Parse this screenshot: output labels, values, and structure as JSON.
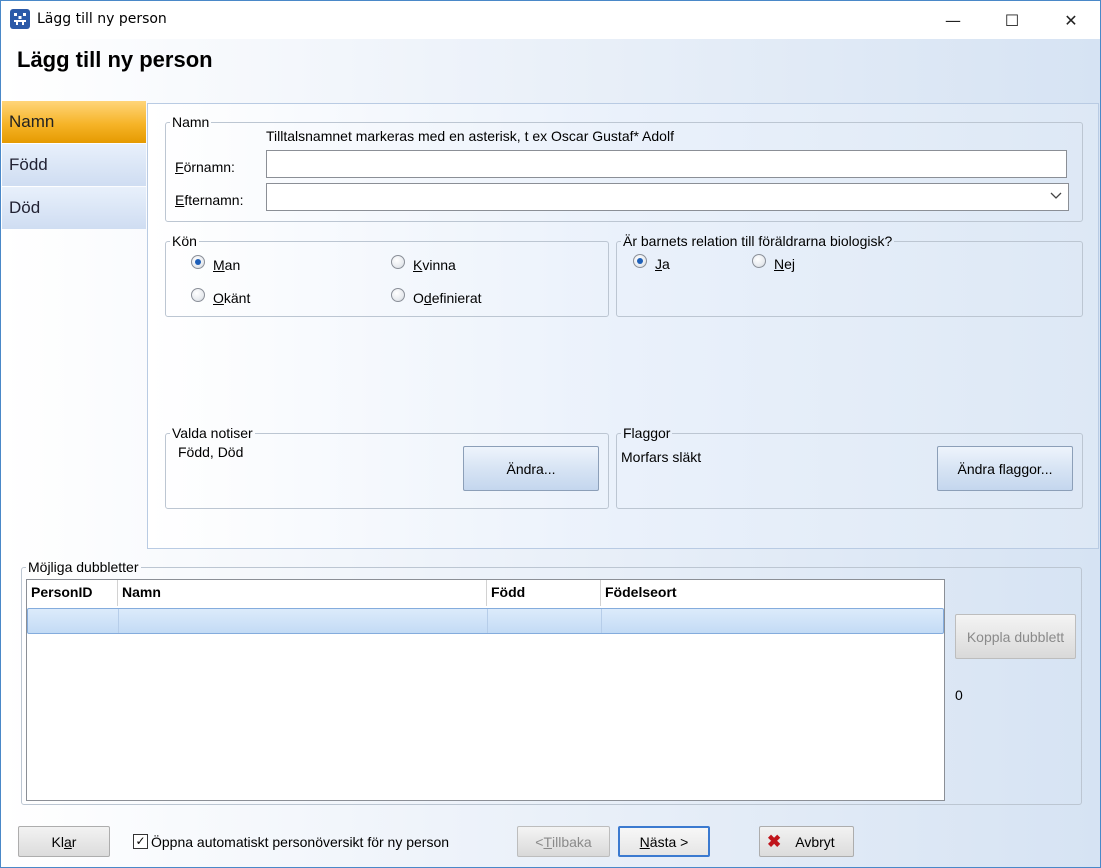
{
  "window": {
    "title": "Lägg till ny person",
    "minimize_glyph": "—",
    "maximize_glyph": "☐",
    "close_glyph": "✕"
  },
  "header": {
    "title": "Lägg till ny person"
  },
  "nav": {
    "items": [
      {
        "label": "Namn",
        "active": true
      },
      {
        "label": "Född",
        "active": false
      },
      {
        "label": "Död",
        "active": false
      }
    ]
  },
  "name_group": {
    "legend": "Namn",
    "hint": "Tilltalsnamnet markeras med en asterisk, t ex  Oscar Gustaf* Adolf",
    "fornamn_label_pre": "",
    "fornamn_label_key": "F",
    "fornamn_label_post": "örnamn:",
    "fornamn_value": "",
    "efternamn_label_pre": "",
    "efternamn_label_key": "E",
    "efternamn_label_post": "fternamn:",
    "efternamn_value": ""
  },
  "kon_group": {
    "legend": "Kön",
    "options": [
      {
        "pre": "",
        "key": "M",
        "post": "an",
        "selected": true
      },
      {
        "pre": "",
        "key": "K",
        "post": "vinna",
        "selected": false
      },
      {
        "pre": "",
        "key": "O",
        "post": "känt",
        "selected": false
      },
      {
        "pre": "O",
        "key": "d",
        "post": "efinierat",
        "selected": false
      }
    ]
  },
  "relation_group": {
    "legend": "Är barnets relation till föräldrarna biologisk?",
    "options": [
      {
        "pre": "",
        "key": "J",
        "post": "a",
        "selected": true
      },
      {
        "pre": "",
        "key": "N",
        "post": "ej",
        "selected": false
      }
    ]
  },
  "notiser_group": {
    "legend": "Valda notiser",
    "value": "Född, Död",
    "button": "Ändra..."
  },
  "flaggor_group": {
    "legend": "Flaggor",
    "value": "Morfars släkt",
    "button": "Ändra flaggor..."
  },
  "duplicates": {
    "legend": "Möjliga dubbletter",
    "columns": [
      "PersonID",
      "Namn",
      "Född",
      "Födelseort"
    ],
    "rows": [
      [
        "",
        "",
        "",
        ""
      ]
    ],
    "link_button": "Koppla dubblett",
    "count": "0"
  },
  "footer": {
    "klar_pre": "Kl",
    "klar_key": "a",
    "klar_post": "r",
    "auto_open_checked": true,
    "auto_open_label": "Öppna automatiskt personöversikt för ny person",
    "back_pre": "< ",
    "back_key": "T",
    "back_post": "illbaka",
    "next_pre": "",
    "next_key": "N",
    "next_post": "ästa >",
    "cancel_label": "Avbryt",
    "check_glyph": "✓",
    "cancel_glyph": "✖"
  },
  "colors": {
    "accent_active_tab": "#f6b428",
    "radio_selected": "#1e5fb8",
    "cancel_icon": "#c0141b"
  }
}
